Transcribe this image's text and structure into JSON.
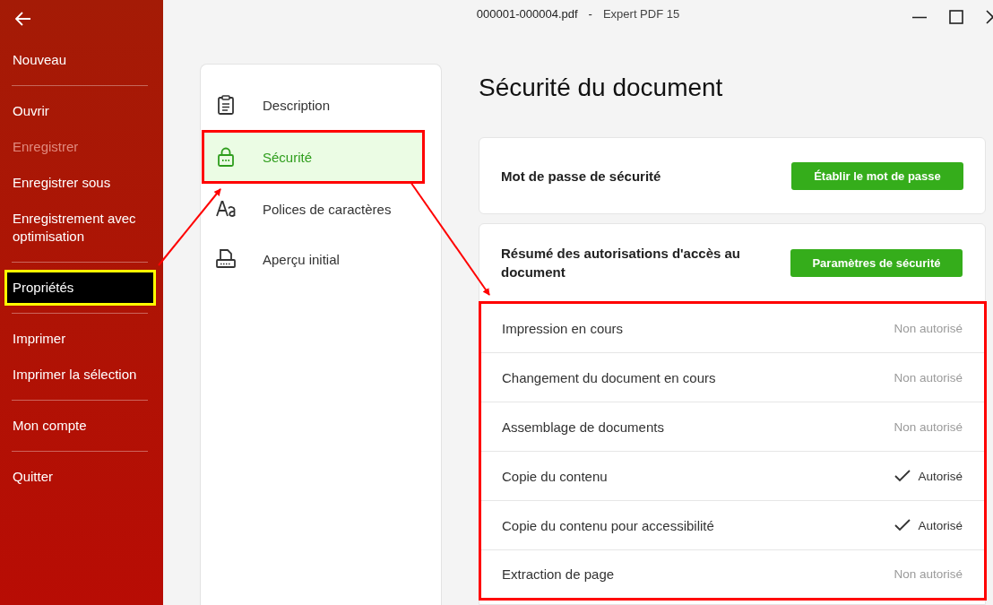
{
  "window": {
    "file_name": "000001-000004.pdf",
    "separator": "-",
    "app_name": "Expert PDF 15"
  },
  "sidebar": {
    "groups": [
      {
        "items": [
          {
            "label": "Nouveau",
            "disabled": false,
            "selected": false
          }
        ]
      },
      {
        "items": [
          {
            "label": "Ouvrir",
            "disabled": false,
            "selected": false
          },
          {
            "label": "Enregistrer",
            "disabled": true,
            "selected": false
          },
          {
            "label": "Enregistrer sous",
            "disabled": false,
            "selected": false
          },
          {
            "label": "Enregistrement avec optimisation",
            "disabled": false,
            "selected": false
          }
        ]
      },
      {
        "items": [
          {
            "label": "Propriétés",
            "disabled": false,
            "selected": true
          }
        ]
      },
      {
        "items": [
          {
            "label": "Imprimer",
            "disabled": false,
            "selected": false
          },
          {
            "label": "Imprimer la sélection",
            "disabled": false,
            "selected": false
          }
        ]
      },
      {
        "items": [
          {
            "label": "Mon compte",
            "disabled": false,
            "selected": false
          }
        ]
      },
      {
        "items": [
          {
            "label": "Quitter",
            "disabled": false,
            "selected": false
          }
        ]
      }
    ]
  },
  "nav": {
    "items": [
      {
        "label": "Description",
        "kind": "clipboard",
        "selected": false
      },
      {
        "label": "Sécurité",
        "kind": "lock",
        "selected": true
      },
      {
        "label": "Polices de caractères",
        "kind": "font",
        "selected": false
      },
      {
        "label": "Aperçu initial",
        "kind": "preview",
        "selected": false
      }
    ]
  },
  "heading": "Sécurité du document",
  "password_card": {
    "label": "Mot de passe de sécurité",
    "button": "Établir le mot de passe"
  },
  "permissions_card": {
    "label": "Résumé des autorisations d'accès au document",
    "button": "Paramètres de sécurité",
    "rows": [
      {
        "name": "Impression en cours",
        "status": "Non autorisé",
        "allowed": false
      },
      {
        "name": "Changement du document en cours",
        "status": "Non autorisé",
        "allowed": false
      },
      {
        "name": "Assemblage de documents",
        "status": "Non autorisé",
        "allowed": false
      },
      {
        "name": "Copie du contenu",
        "status": "Autorisé",
        "allowed": true
      },
      {
        "name": "Copie du contenu pour accessibilité",
        "status": "Autorisé",
        "allowed": true
      },
      {
        "name": "Extraction de page",
        "status": "Non autorisé",
        "allowed": false
      }
    ]
  }
}
